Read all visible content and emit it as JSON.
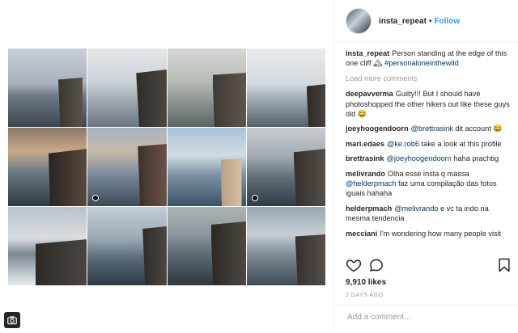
{
  "post": {
    "username": "insta_repeat",
    "follow_label": "Follow",
    "separator": "•",
    "caption_user": "insta_repeat",
    "caption_text": "Person standing at the edge of this one cliff 🏔 ",
    "caption_hashtag": "#personaloneinthewild",
    "load_more": "Load more comments",
    "likes": "9,910 likes",
    "date": "2 DAYS AGO",
    "add_comment_placeholder": "Add a comment..."
  },
  "comments": [
    {
      "user": "deepavverma",
      "parts": [
        {
          "t": "Guilty!!! But I should have photoshopped the other hikers out like these guys did 😂"
        }
      ]
    },
    {
      "user": "joeyhoogendoorn",
      "parts": [
        {
          "m": "@brettrasink"
        },
        {
          "t": " dit account 😂"
        }
      ]
    },
    {
      "user": "mari.edaes",
      "parts": [
        {
          "m": "@ke.rob6"
        },
        {
          "t": " take a look at this profile"
        }
      ]
    },
    {
      "user": "brettrasink",
      "parts": [
        {
          "m": "@joeyhoogendoorn"
        },
        {
          "t": " haha prachtig"
        }
      ]
    },
    {
      "user": "melivrando",
      "parts": [
        {
          "t": "Olha esse insta q massa "
        },
        {
          "m": "@helderpmach"
        },
        {
          "t": " faz uma compilação das fotos iguais hahaha"
        }
      ]
    },
    {
      "user": "helderpmach",
      "parts": [
        {
          "m": "@melivrando"
        },
        {
          "t": " e vc ta indo na mesma tendencia"
        }
      ]
    },
    {
      "user": "mecciani",
      "parts": [
        {
          "t": "I'm wondering how many people visit"
        }
      ]
    }
  ],
  "colors": {
    "accent": "#3897f0",
    "mention": "#003569",
    "text": "#262626",
    "muted": "#999999"
  },
  "icons": {
    "like": "heart-icon",
    "comment": "comment-icon",
    "save": "bookmark-icon",
    "corner": "camera-icon"
  }
}
